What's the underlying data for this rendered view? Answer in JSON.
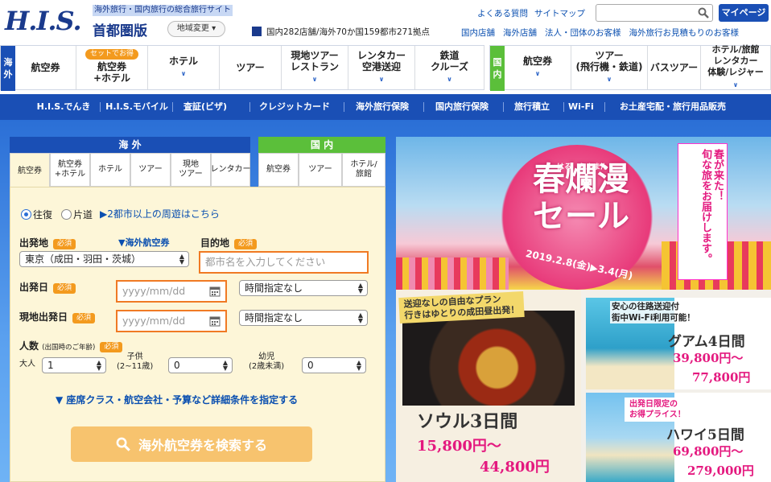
{
  "header": {
    "tagline": "海外旅行・国内旅行の総合旅行サイト",
    "region": "首都圏版",
    "region_button": "地域変更",
    "stats": "国内282店舗/海外70か国159都市271拠点",
    "store_links": [
      "国内店舗",
      "海外店舗",
      "法人・団体のお客様",
      "海外旅行お見積もりのお客様"
    ],
    "top_links": [
      "よくある質問",
      "サイトマップ"
    ],
    "search_placeholder": "",
    "mypage": "マイページ"
  },
  "nav": {
    "overseas_side": [
      "海",
      "外"
    ],
    "domestic_side": [
      "国",
      "内"
    ],
    "overseas_items": [
      {
        "label": "航空券",
        "chevron": false
      },
      {
        "label": "航空券\n+ホテル",
        "badge": "セットでお得",
        "chevron": false
      },
      {
        "label": "ホテル",
        "chevron": true
      },
      {
        "label": "ツアー",
        "chevron": false
      },
      {
        "label": "現地ツアー\nレストラン",
        "chevron": true
      },
      {
        "label": "レンタカー\n空港送迎",
        "chevron": true
      },
      {
        "label": "鉄道\nクルーズ",
        "chevron": true
      }
    ],
    "domestic_items": [
      {
        "label": "航空券",
        "chevron": true
      },
      {
        "label": "ツアー\n(飛行機・鉄道)",
        "chevron": true
      },
      {
        "label": "バスツアー",
        "chevron": false
      },
      {
        "label": "ホテル/旅館\nレンタカー\n体験/レジャー",
        "chevron": true
      }
    ]
  },
  "subnav": [
    "H.I.S.でんき",
    "H.I.S.モバイル",
    "査証(ビザ)",
    "クレジットカード",
    "海外旅行保険",
    "国内旅行保険",
    "旅行積立",
    "Wi-Fi",
    "お土産宅配・旅行用品販売"
  ],
  "panel": {
    "overseas_header": "海 外",
    "domestic_header": "国 内",
    "overseas_tabs": [
      "航空券",
      "航空券\n+ホテル",
      "ホテル",
      "ツアー",
      "現地\nツアー",
      "レンタカー"
    ],
    "domestic_tabs": [
      "航空券",
      "ツアー",
      "ホテル/\n旅館"
    ],
    "trip_roundtrip": "往復",
    "trip_oneway": "片道",
    "multi_city": "▶2都市以上の周遊はこちら",
    "required": "必須",
    "departure_label": "出発地",
    "departure_value": "東京（成田・羽田・茨城）",
    "airline_link": "▼海外航空券",
    "destination_label": "目的地",
    "destination_placeholder": "都市名を入力してください",
    "depart_date_label": "出発日",
    "date_placeholder": "yyyy/mm/dd",
    "time_value": "時間指定なし",
    "local_depart_label": "現地出発日",
    "people_label": "人数",
    "people_note": "(出国時のご年齢)",
    "adult_label": "大人",
    "adult_value": "1",
    "child_label": "子供\n(2~11歳)",
    "child_value": "0",
    "infant_label": "幼児\n(2歳未満)",
    "infant_value": "0",
    "detail_link": "▼ 座席クラス・航空会社・予算など詳細条件を指定する",
    "search_button": "海外航空券を検索する"
  },
  "banner": {
    "main_title": "春爛漫\nセール",
    "ruby": "はる　らんまん",
    "date_range": "2019.2.8(金)▶3.4(月)",
    "side_copy": "春が来た！\n旬な旅をお届けします。",
    "seoul_tag": "送迎なしの自由なプラン\n行きはゆとりの成田昼出発！",
    "seoul_title": "ソウル3日間",
    "seoul_price_from": "15,800円〜",
    "seoul_price_to": "44,800円",
    "guam_tag": "安心の往路送迎付\n街中Wi-Fi利用可能！",
    "guam_title": "グアム4日間",
    "guam_price_from": "39,800円〜",
    "guam_price_to": "77,800円",
    "hawaii_tag": "出発日限定の\nお得プライス！",
    "hawaii_title": "ハワイ5日間",
    "hawaii_price_from": "69,800円〜",
    "hawaii_price_to": "279,000円"
  },
  "colors": {
    "brand_blue": "#1a4fb5",
    "domestic_green": "#5bbf3a",
    "accent_orange": "#f39a1e",
    "price_pink": "#e4197f"
  }
}
